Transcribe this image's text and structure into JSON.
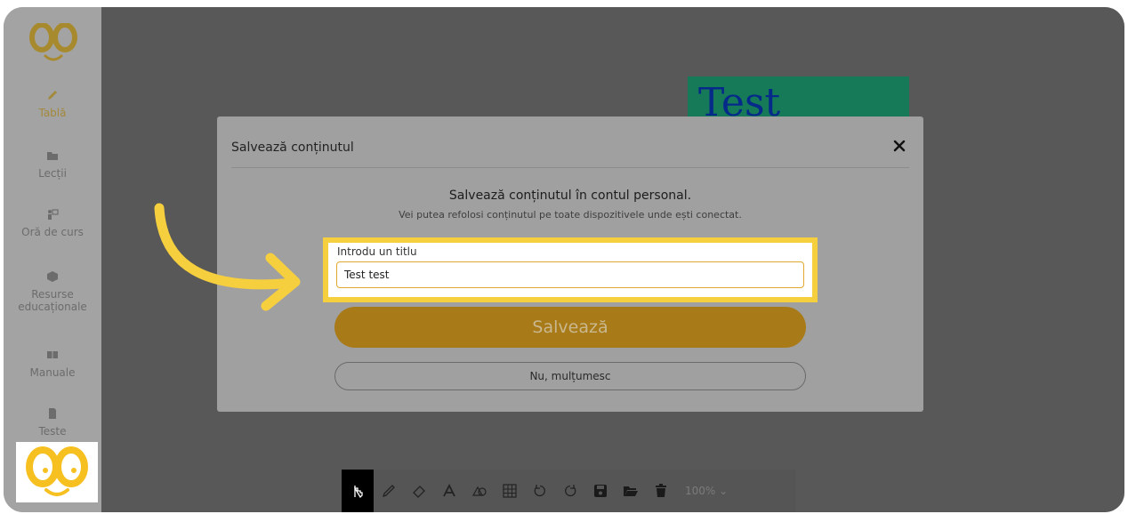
{
  "sidebar": {
    "items": [
      {
        "label": "Tablă",
        "icon": "pencil-icon"
      },
      {
        "label": "Lecții",
        "icon": "folder-icon"
      },
      {
        "label": "Oră de curs",
        "icon": "teacher-icon"
      },
      {
        "label": "Resurse educaționale",
        "icon": "cube-icon"
      },
      {
        "label": "Manuale",
        "icon": "book-icon"
      },
      {
        "label": "Teste",
        "icon": "document-icon"
      }
    ]
  },
  "canvas": {
    "text_box": "Test"
  },
  "toolbar": {
    "tools": [
      "hand-icon",
      "pen-icon",
      "eraser-icon",
      "text-icon",
      "shapes-icon",
      "table-icon",
      "undo-icon",
      "redo-icon",
      "save-icon",
      "open-folder-icon",
      "trash-icon"
    ],
    "zoom": "100%"
  },
  "modal": {
    "title": "Salvează conținutul",
    "heading": "Salvează conținutul în contul personal.",
    "subheading": "Vei putea refolosi conținutul pe toate dispozitivele unde ești conectat.",
    "field_label": "Introdu un titlu",
    "field_value": "Test test",
    "save_label": "Salvează",
    "decline_label": "Nu, mulțumesc"
  },
  "colors": {
    "accent_yellow": "#f6cf3e",
    "save_button": "#a97a18",
    "canvas_box": "#167a58"
  }
}
